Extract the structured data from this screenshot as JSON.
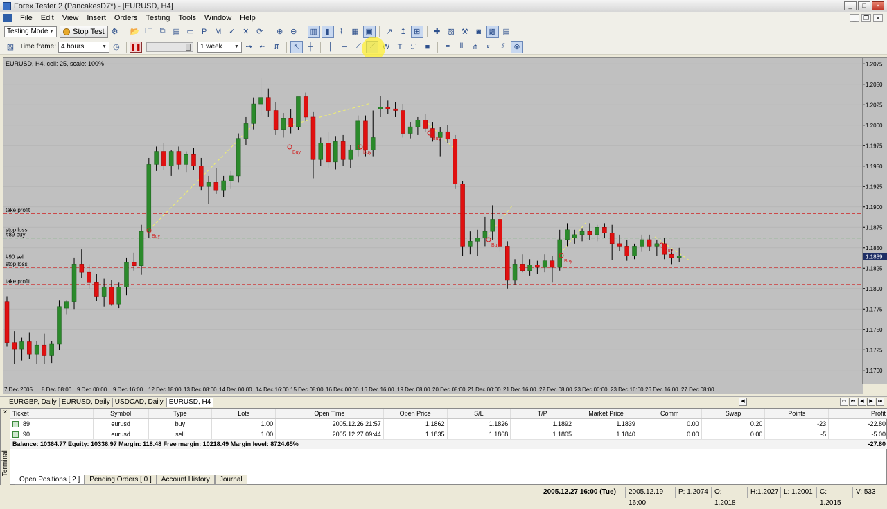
{
  "window": {
    "title": "Forex Tester 2  (PancakesD7*) - [EURUSD, H4]",
    "buttons": [
      "_",
      "□",
      "×"
    ]
  },
  "menu": {
    "items": [
      "File",
      "Edit",
      "View",
      "Insert",
      "Orders",
      "Testing",
      "Tools",
      "Window",
      "Help"
    ]
  },
  "toolbar1": {
    "mode_value": "Testing Mode",
    "stop_label": "Stop Test"
  },
  "toolbar2": {
    "timeframe_label": "Time frame:",
    "timeframe_value": "4 hours",
    "period_value": "1 week"
  },
  "chart": {
    "info": "EURUSD, H4, cell: 25, scale: 100%",
    "current_price_label": "1.1839",
    "colors": {
      "background": "#c0c0c0",
      "bull": "#2b8a2b",
      "bear": "#e01010",
      "wick": "#000000",
      "tp_line": "#d02020",
      "sl_line": "#d02020",
      "fib": "#f0f070"
    },
    "order_labels": {
      "tp_upper": "take profit",
      "sl_upper": "stop loss",
      "buy_ticket": "#89 buy",
      "sell_ticket": "#90 sell",
      "sl_lower": "stop loss",
      "tp_lower": "take profit"
    },
    "trade_marks": [
      "Buy",
      "Buy",
      "Buy",
      "Buy",
      "Buy",
      "Buy"
    ]
  },
  "chart_data": {
    "type": "candlestick",
    "price_ticks": [
      "1.2075",
      "1.2050",
      "1.2025",
      "1.2000",
      "1.1975",
      "1.1950",
      "1.1925",
      "1.1900",
      "1.1875",
      "1.1850",
      "1.1825",
      "1.1800",
      "1.1775",
      "1.1750",
      "1.1725",
      "1.1700"
    ],
    "date_ticks": [
      "7 Dec 2005",
      "8 Dec 08:00",
      "9 Dec 00:00",
      "9 Dec 16:00",
      "12 Dec 18:00",
      "13 Dec 08:00",
      "14 Dec 00:00",
      "14 Dec 16:00",
      "15 Dec 08:00",
      "16 Dec 00:00",
      "16 Dec 16:00",
      "19 Dec 08:00",
      "20 Dec 08:00",
      "21 Dec 00:00",
      "21 Dec 16:00",
      "22 Dec 08:00",
      "23 Dec 00:00",
      "23 Dec 16:00",
      "26 Dec 16:00",
      "27 Dec 08:00"
    ],
    "ylim": [
      1.1682,
      1.2082
    ],
    "horizontal_lines": [
      {
        "label": "take profit",
        "price": 1.1892
      },
      {
        "label": "stop loss",
        "price": 1.1868
      },
      {
        "label": "#89 buy",
        "price": 1.1862
      },
      {
        "label": "#90 sell",
        "price": 1.1835
      },
      {
        "label": "stop loss",
        "price": 1.1826
      },
      {
        "label": "take profit",
        "price": 1.1805
      }
    ],
    "candles": [
      {
        "o": 1.1784,
        "h": 1.179,
        "l": 1.1729,
        "c": 1.1734
      },
      {
        "o": 1.1734,
        "h": 1.1748,
        "l": 1.1708,
        "c": 1.1726
      },
      {
        "o": 1.1726,
        "h": 1.174,
        "l": 1.1712,
        "c": 1.1735
      },
      {
        "o": 1.1735,
        "h": 1.1746,
        "l": 1.1714,
        "c": 1.172
      },
      {
        "o": 1.172,
        "h": 1.1736,
        "l": 1.1708,
        "c": 1.1731
      },
      {
        "o": 1.1731,
        "h": 1.1745,
        "l": 1.1708,
        "c": 1.1718
      },
      {
        "o": 1.1718,
        "h": 1.1736,
        "l": 1.1709,
        "c": 1.1732
      },
      {
        "o": 1.1732,
        "h": 1.1786,
        "l": 1.1725,
        "c": 1.1778
      },
      {
        "o": 1.1776,
        "h": 1.1786,
        "l": 1.1768,
        "c": 1.1784
      },
      {
        "o": 1.1784,
        "h": 1.1838,
        "l": 1.1775,
        "c": 1.183
      },
      {
        "o": 1.183,
        "h": 1.1848,
        "l": 1.1813,
        "c": 1.182
      },
      {
        "o": 1.182,
        "h": 1.183,
        "l": 1.18,
        "c": 1.1808
      },
      {
        "o": 1.1808,
        "h": 1.1818,
        "l": 1.1785,
        "c": 1.179
      },
      {
        "o": 1.179,
        "h": 1.1812,
        "l": 1.1778,
        "c": 1.1802
      },
      {
        "o": 1.1802,
        "h": 1.181,
        "l": 1.1779,
        "c": 1.1781
      },
      {
        "o": 1.1781,
        "h": 1.1808,
        "l": 1.1776,
        "c": 1.1802
      },
      {
        "o": 1.1802,
        "h": 1.1838,
        "l": 1.1792,
        "c": 1.1832
      },
      {
        "o": 1.1832,
        "h": 1.1844,
        "l": 1.1822,
        "c": 1.1828
      },
      {
        "o": 1.1828,
        "h": 1.1878,
        "l": 1.1817,
        "c": 1.187
      },
      {
        "o": 1.187,
        "h": 1.196,
        "l": 1.1862,
        "c": 1.1952
      },
      {
        "o": 1.1952,
        "h": 1.1974,
        "l": 1.1944,
        "c": 1.1968
      },
      {
        "o": 1.1968,
        "h": 1.1978,
        "l": 1.1945,
        "c": 1.195
      },
      {
        "o": 1.195,
        "h": 1.197,
        "l": 1.1938,
        "c": 1.1968
      },
      {
        "o": 1.1968,
        "h": 1.1974,
        "l": 1.1946,
        "c": 1.1952
      },
      {
        "o": 1.1952,
        "h": 1.1968,
        "l": 1.1942,
        "c": 1.1964
      },
      {
        "o": 1.1964,
        "h": 1.1972,
        "l": 1.1945,
        "c": 1.195
      },
      {
        "o": 1.195,
        "h": 1.196,
        "l": 1.192,
        "c": 1.1925
      },
      {
        "o": 1.1925,
        "h": 1.1938,
        "l": 1.1904,
        "c": 1.193
      },
      {
        "o": 1.193,
        "h": 1.1948,
        "l": 1.1916,
        "c": 1.192
      },
      {
        "o": 1.192,
        "h": 1.1938,
        "l": 1.1912,
        "c": 1.1932
      },
      {
        "o": 1.1932,
        "h": 1.1944,
        "l": 1.1922,
        "c": 1.1938
      },
      {
        "o": 1.1938,
        "h": 1.199,
        "l": 1.193,
        "c": 1.1984
      },
      {
        "o": 1.1984,
        "h": 1.201,
        "l": 1.1976,
        "c": 1.2002
      },
      {
        "o": 1.2002,
        "h": 1.2034,
        "l": 1.1995,
        "c": 1.2026
      },
      {
        "o": 1.2026,
        "h": 1.2058,
        "l": 1.2012,
        "c": 1.2034
      },
      {
        "o": 1.2034,
        "h": 1.2045,
        "l": 1.201,
        "c": 1.2018
      },
      {
        "o": 1.2018,
        "h": 1.2028,
        "l": 1.1988,
        "c": 1.1995
      },
      {
        "o": 1.1995,
        "h": 1.2015,
        "l": 1.1985,
        "c": 1.2008
      },
      {
        "o": 1.2008,
        "h": 1.202,
        "l": 1.199,
        "c": 1.1998
      },
      {
        "o": 1.1998,
        "h": 1.203,
        "l": 1.1994,
        "c": 1.2035
      },
      {
        "o": 1.2035,
        "h": 1.204,
        "l": 1.2005,
        "c": 1.201
      },
      {
        "o": 1.201,
        "h": 1.2016,
        "l": 1.1935,
        "c": 1.1958
      },
      {
        "o": 1.1958,
        "h": 1.1985,
        "l": 1.195,
        "c": 1.1978
      },
      {
        "o": 1.1978,
        "h": 1.1992,
        "l": 1.1948,
        "c": 1.1955
      },
      {
        "o": 1.1955,
        "h": 1.1986,
        "l": 1.1946,
        "c": 1.198
      },
      {
        "o": 1.198,
        "h": 1.1988,
        "l": 1.195,
        "c": 1.1958
      },
      {
        "o": 1.1958,
        "h": 1.1976,
        "l": 1.1948,
        "c": 1.197
      },
      {
        "o": 1.197,
        "h": 1.2012,
        "l": 1.1962,
        "c": 1.2005
      },
      {
        "o": 1.2005,
        "h": 1.2012,
        "l": 1.1962,
        "c": 1.197
      },
      {
        "o": 1.197,
        "h": 1.2018,
        "l": 1.1962,
        "c": 1.1985
      },
      {
        "o": 1.202,
        "h": 1.2036,
        "l": 1.201,
        "c": 1.2022
      },
      {
        "o": 1.2022,
        "h": 1.203,
        "l": 1.2014,
        "c": 1.202
      },
      {
        "o": 1.202,
        "h": 1.2028,
        "l": 1.201,
        "c": 1.2018
      },
      {
        "o": 1.2018,
        "h": 1.2026,
        "l": 1.1985,
        "c": 1.199
      },
      {
        "o": 1.199,
        "h": 1.2004,
        "l": 1.1984,
        "c": 1.1998
      },
      {
        "o": 1.1998,
        "h": 1.201,
        "l": 1.1988,
        "c": 1.2006
      },
      {
        "o": 1.2006,
        "h": 1.2014,
        "l": 1.1992,
        "c": 1.1996
      },
      {
        "o": 1.1996,
        "h": 1.2004,
        "l": 1.198,
        "c": 1.1985
      },
      {
        "o": 1.1985,
        "h": 1.1998,
        "l": 1.1962,
        "c": 1.1992
      },
      {
        "o": 1.1992,
        "h": 1.2,
        "l": 1.1978,
        "c": 1.1983
      },
      {
        "o": 1.1983,
        "h": 1.1988,
        "l": 1.1922,
        "c": 1.1928
      },
      {
        "o": 1.1928,
        "h": 1.1932,
        "l": 1.184,
        "c": 1.1852
      },
      {
        "o": 1.1852,
        "h": 1.187,
        "l": 1.1842,
        "c": 1.1858
      },
      {
        "o": 1.1858,
        "h": 1.1872,
        "l": 1.184,
        "c": 1.1862
      },
      {
        "o": 1.1862,
        "h": 1.1888,
        "l": 1.1852,
        "c": 1.187
      },
      {
        "o": 1.187,
        "h": 1.1902,
        "l": 1.186,
        "c": 1.1885
      },
      {
        "o": 1.1885,
        "h": 1.1894,
        "l": 1.1845,
        "c": 1.1852
      },
      {
        "o": 1.1852,
        "h": 1.1858,
        "l": 1.18,
        "c": 1.181
      },
      {
        "o": 1.181,
        "h": 1.1836,
        "l": 1.1805,
        "c": 1.183
      },
      {
        "o": 1.183,
        "h": 1.1842,
        "l": 1.182,
        "c": 1.1822
      },
      {
        "o": 1.1822,
        "h": 1.1836,
        "l": 1.1816,
        "c": 1.1829
      },
      {
        "o": 1.1829,
        "h": 1.1834,
        "l": 1.1818,
        "c": 1.1826
      },
      {
        "o": 1.1826,
        "h": 1.1842,
        "l": 1.182,
        "c": 1.1834
      },
      {
        "o": 1.1834,
        "h": 1.184,
        "l": 1.1808,
        "c": 1.1826
      },
      {
        "o": 1.1826,
        "h": 1.1872,
        "l": 1.1822,
        "c": 1.186
      },
      {
        "o": 1.186,
        "h": 1.188,
        "l": 1.1852,
        "c": 1.1872
      },
      {
        "o": 1.1862,
        "h": 1.1872,
        "l": 1.1855,
        "c": 1.1866
      },
      {
        "o": 1.1866,
        "h": 1.1874,
        "l": 1.1858,
        "c": 1.187
      },
      {
        "o": 1.187,
        "h": 1.188,
        "l": 1.186,
        "c": 1.1866
      },
      {
        "o": 1.1866,
        "h": 1.1878,
        "l": 1.1858,
        "c": 1.1875
      },
      {
        "o": 1.1875,
        "h": 1.188,
        "l": 1.1862,
        "c": 1.1868
      },
      {
        "o": 1.1868,
        "h": 1.1878,
        "l": 1.1835,
        "c": 1.1855
      },
      {
        "o": 1.1855,
        "h": 1.1866,
        "l": 1.1846,
        "c": 1.1852
      },
      {
        "o": 1.1852,
        "h": 1.186,
        "l": 1.1834,
        "c": 1.184
      },
      {
        "o": 1.184,
        "h": 1.1855,
        "l": 1.1836,
        "c": 1.1852
      },
      {
        "o": 1.1852,
        "h": 1.1866,
        "l": 1.1845,
        "c": 1.186
      },
      {
        "o": 1.186,
        "h": 1.1866,
        "l": 1.1846,
        "c": 1.1852
      },
      {
        "o": 1.1852,
        "h": 1.186,
        "l": 1.184,
        "c": 1.1855
      },
      {
        "o": 1.1855,
        "h": 1.1862,
        "l": 1.1836,
        "c": 1.1842
      },
      {
        "o": 1.1842,
        "h": 1.1848,
        "l": 1.183,
        "c": 1.1838
      },
      {
        "o": 1.1838,
        "h": 1.185,
        "l": 1.1832,
        "c": 1.184
      }
    ]
  },
  "chart_tabs": [
    "EURGBP, Daily",
    "EURUSD, Daily",
    "USDCAD, Daily",
    "EURUSD, H4"
  ],
  "terminal": {
    "side_label": "Terminal",
    "close_label": "×",
    "columns": [
      "Ticket",
      "Symbol",
      "Type",
      "Lots",
      "Open Time",
      "Open Price",
      "S/L",
      "T/P",
      "Market Price",
      "Comm",
      "Swap",
      "Points",
      "Profit"
    ],
    "rows": [
      {
        "ticket": "89",
        "symbol": "eurusd",
        "type": "buy",
        "lots": "1.00",
        "open_time": "2005.12.26 21:57",
        "open_price": "1.1862",
        "sl": "1.1826",
        "tp": "1.1892",
        "market_price": "1.1839",
        "comm": "0.00",
        "swap": "0.20",
        "points": "-23",
        "profit": "-22.80"
      },
      {
        "ticket": "90",
        "symbol": "eurusd",
        "type": "sell",
        "lots": "1.00",
        "open_time": "2005.12.27 09:44",
        "open_price": "1.1835",
        "sl": "1.1868",
        "tp": "1.1805",
        "market_price": "1.1840",
        "comm": "0.00",
        "swap": "0.00",
        "points": "-5",
        "profit": "-5.00"
      }
    ],
    "balance_text": "Balance: 10364.77 Equity: 10336.97 Margin: 118.48 Free margin: 10218.49 Margin level: 8724.65%",
    "balance_profit": "-27.80",
    "tabs": [
      "Open Positions  [ 2 ]",
      "Pending Orders  [ 0 ]",
      "Account History",
      "Journal"
    ]
  },
  "status": {
    "datetime": "2005.12.27 16:00 (Tue)",
    "bar_time": "2005.12.19 16:00",
    "p": "P: 1.2074",
    "o": "O: 1.2018",
    "h": "H:1.2027",
    "l": "L: 1.2001",
    "c": "C: 1.2015",
    "v": "V: 533"
  }
}
